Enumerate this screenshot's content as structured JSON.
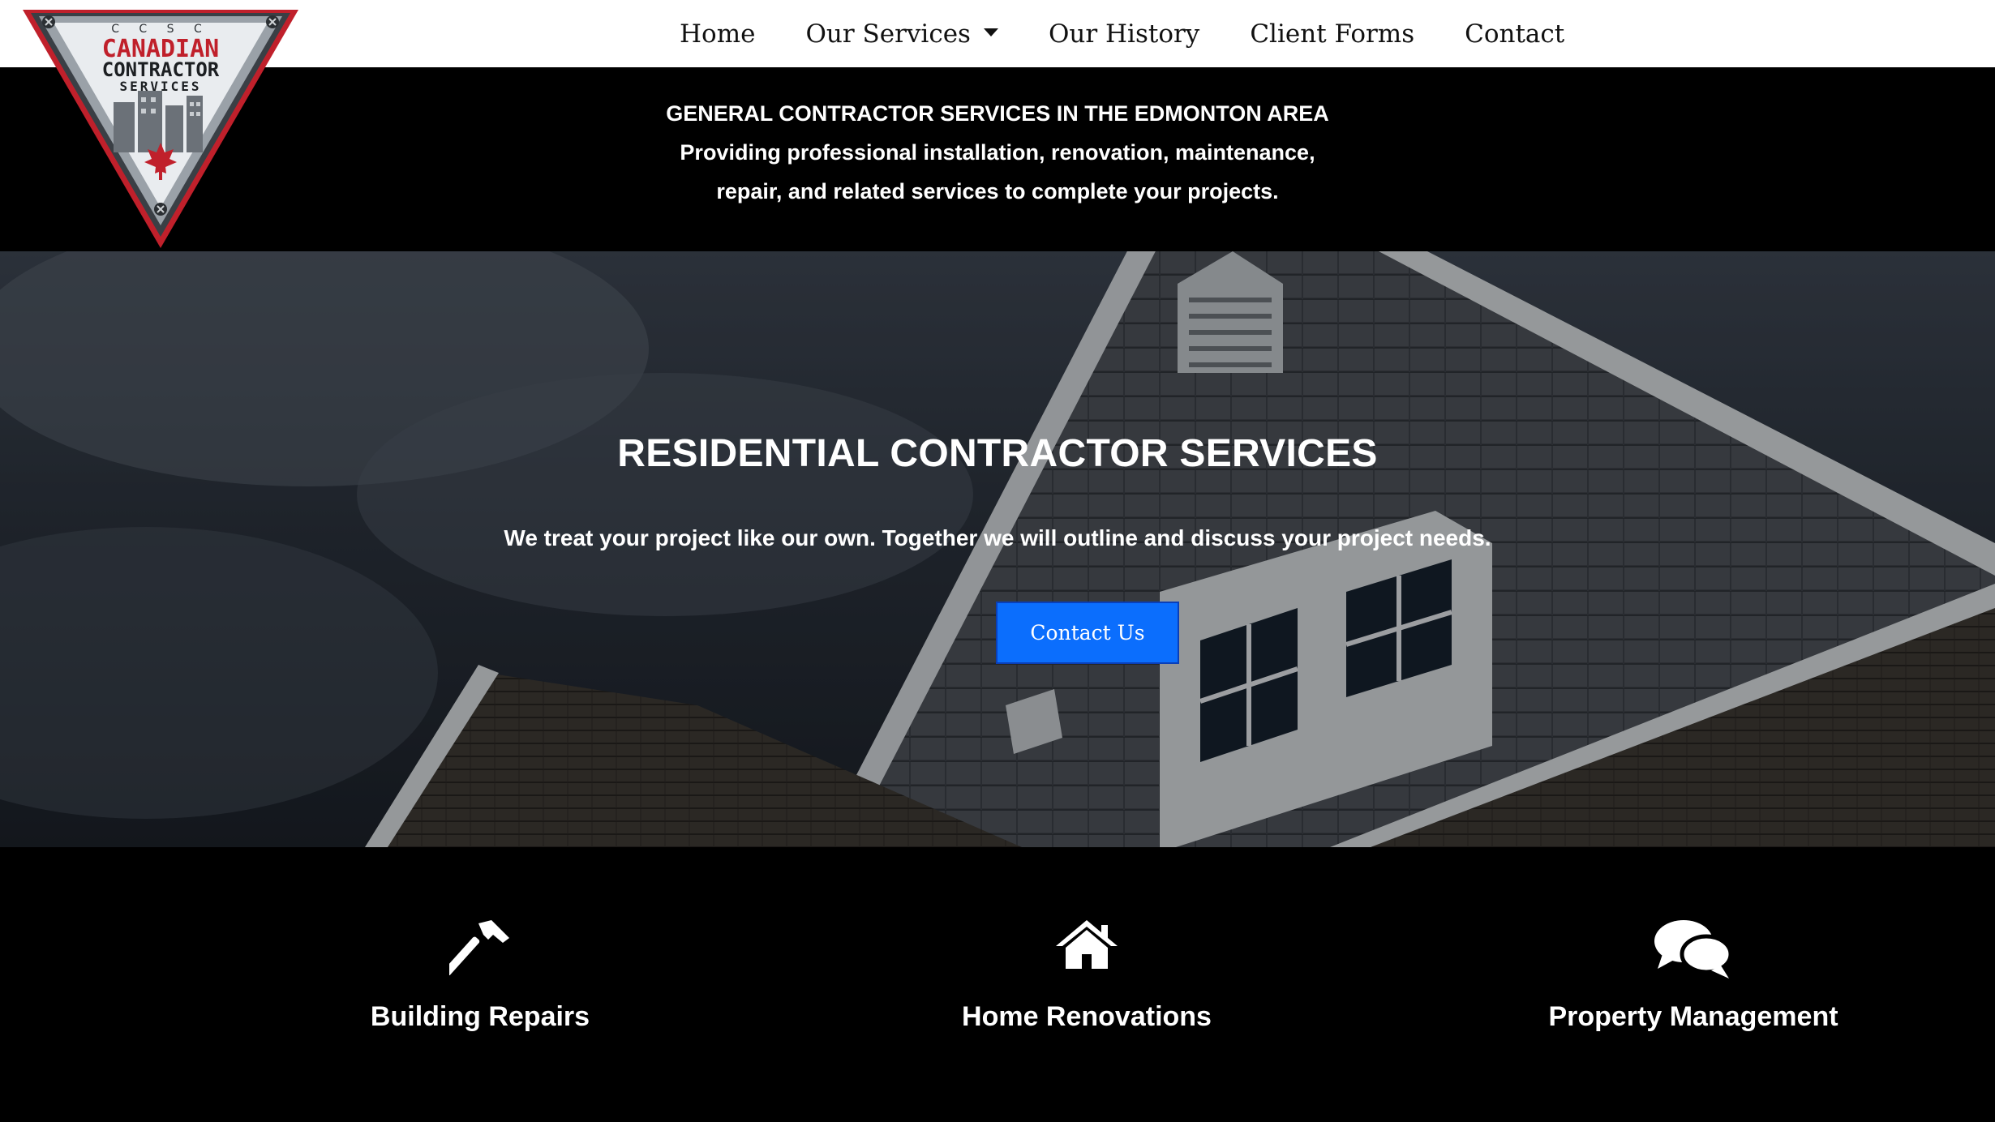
{
  "logo": {
    "top_text": "C C S C",
    "line1": "CANADIAN",
    "line2": "CONTRACTOR",
    "line3": "SERVICES"
  },
  "nav": {
    "items": [
      {
        "label": "Home"
      },
      {
        "label": "Our Services"
      },
      {
        "label": "Our History"
      },
      {
        "label": "Client Forms"
      },
      {
        "label": "Contact"
      }
    ]
  },
  "tagline": {
    "line1": "GENERAL CONTRACTOR SERVICES IN THE EDMONTON AREA",
    "line2": "Providing professional installation, renovation, maintenance,",
    "line3": "repair, and related services to complete your projects."
  },
  "hero": {
    "title": "RESIDENTIAL CONTRACTOR SERVICES",
    "subtitle": "We treat your project like our own. Together we will outline and discuss your project needs.",
    "button_label": "Contact Us"
  },
  "services": [
    {
      "label": "Building Repairs",
      "icon": "hammer-icon"
    },
    {
      "label": "Home Renovations",
      "icon": "home-icon"
    },
    {
      "label": "Property Management",
      "icon": "comments-icon"
    }
  ],
  "colors": {
    "accent": "#0b6efd",
    "logo_red": "#c0202b",
    "nav_bg": "#ffffff",
    "page_bg": "#000000"
  }
}
